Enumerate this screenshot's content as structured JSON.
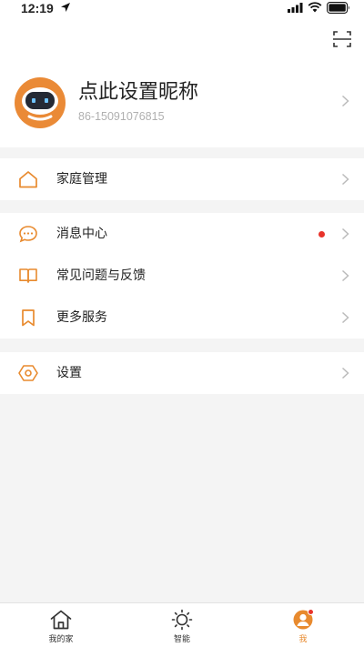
{
  "status_bar": {
    "time": "12:19"
  },
  "profile": {
    "nickname": "点此设置昵称",
    "account_id": "86-15091076815"
  },
  "menu": {
    "group1": [
      {
        "label": "家庭管理",
        "icon": "home-icon"
      }
    ],
    "group2": [
      {
        "label": "消息中心",
        "icon": "message-icon",
        "has_unread_dot": true
      },
      {
        "label": "常见问题与反馈",
        "icon": "book-icon"
      },
      {
        "label": "更多服务",
        "icon": "bookmark-icon"
      }
    ],
    "group3": [
      {
        "label": "设置",
        "icon": "settings-hexagon-icon"
      }
    ]
  },
  "tab_bar": {
    "tabs": [
      {
        "label": "我的家",
        "icon": "home-tab-icon",
        "active": false
      },
      {
        "label": "智能",
        "icon": "sun-icon",
        "active": false
      },
      {
        "label": "我",
        "icon": "profile-tab-icon",
        "active": true
      }
    ]
  },
  "colors": {
    "accent": "#e88a2e",
    "unread_dot": "#e8332a",
    "background": "#f4f4f4"
  }
}
